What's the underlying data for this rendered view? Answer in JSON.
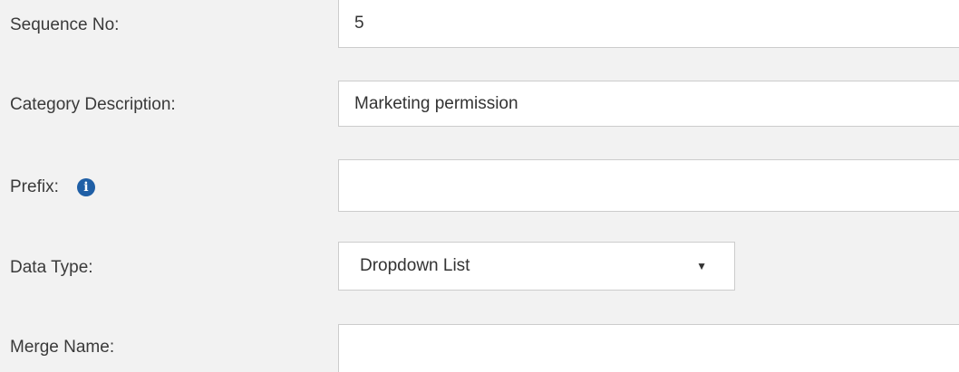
{
  "form": {
    "sequence_no": {
      "label": "Sequence No:",
      "value": "5"
    },
    "category_description": {
      "label": "Category Description:",
      "value": "Marketing permission"
    },
    "prefix": {
      "label": "Prefix:",
      "value": "",
      "info_icon": "info-icon"
    },
    "data_type": {
      "label": "Data Type:",
      "selected": "Dropdown List",
      "arrow_icon": "dropdown-arrow-icon",
      "arrow_glyph": "▼"
    },
    "merge_name": {
      "label": "Merge Name:",
      "value": ""
    }
  }
}
